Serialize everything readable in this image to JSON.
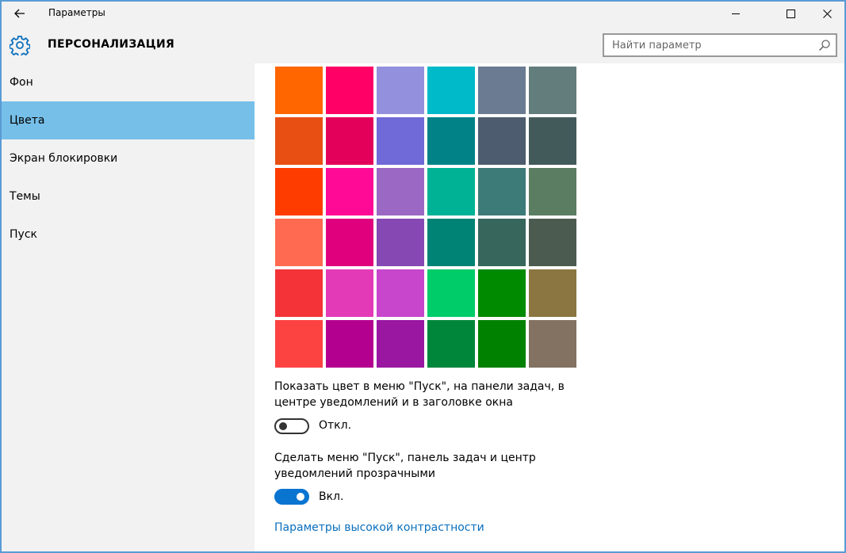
{
  "window": {
    "title": "Параметры",
    "border_color": "#5a9bd5"
  },
  "header": {
    "title": "ПЕРСОНАЛИЗАЦИЯ",
    "icon": "gear-icon"
  },
  "search": {
    "placeholder": "Найти параметр",
    "value": ""
  },
  "sidebar": {
    "items": [
      {
        "label": "Фон",
        "active": false
      },
      {
        "label": "Цвета",
        "active": true
      },
      {
        "label": "Экран блокировки",
        "active": false
      },
      {
        "label": "Темы",
        "active": false
      },
      {
        "label": "Пуск",
        "active": false
      }
    ]
  },
  "colors": {
    "palette": [
      [
        "#ff6600",
        "#ff0066",
        "#9390dd",
        "#00b9c9",
        "#6b7b92",
        "#637c7c"
      ],
      [
        "#e75012",
        "#e3005a",
        "#7069d8",
        "#008287",
        "#4e5c6f",
        "#435a5b"
      ],
      [
        "#ff3c00",
        "#ff0a97",
        "#9b68c3",
        "#00b295",
        "#3d7b78",
        "#5b7d61"
      ],
      [
        "#ff6a50",
        "#e0007e",
        "#8648b3",
        "#008375",
        "#37665d",
        "#4c5b50"
      ],
      [
        "#f33338",
        "#e33ab8",
        "#c746cc",
        "#00cc6a",
        "#008a00",
        "#8b7641"
      ],
      [
        "#fd4242",
        "#b4008f",
        "#9a17a2",
        "#00863a",
        "#008100",
        "#837261"
      ]
    ]
  },
  "settings": {
    "show_color": {
      "label": "Показать цвет в меню \"Пуск\", на панели задач, в центре уведомлений и в заголовке окна",
      "state": "Откл.",
      "on": false
    },
    "transparent": {
      "label": "Сделать меню \"Пуск\", панель задач и центр уведомлений прозрачными",
      "state": "Вкл.",
      "on": true
    },
    "high_contrast_link": "Параметры высокой контрастности"
  },
  "accent_colors": {
    "nav_active": "#76bfe9",
    "toggle_on": "#0a74d1",
    "link": "#0a6fbd"
  }
}
